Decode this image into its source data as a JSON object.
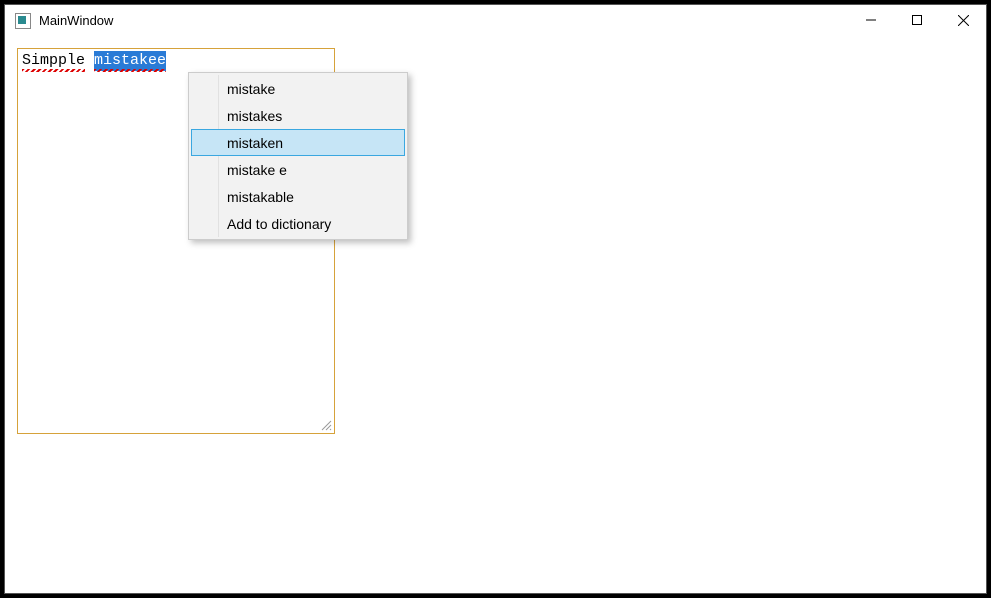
{
  "window": {
    "title": "MainWindow"
  },
  "editor": {
    "word1": "Simpple",
    "word2": "mistakee"
  },
  "context_menu": {
    "items": [
      "mistake",
      "mistakes",
      "mistaken",
      "mistake e",
      "mistakable",
      "Add to dictionary"
    ],
    "highlighted_index": 2
  }
}
